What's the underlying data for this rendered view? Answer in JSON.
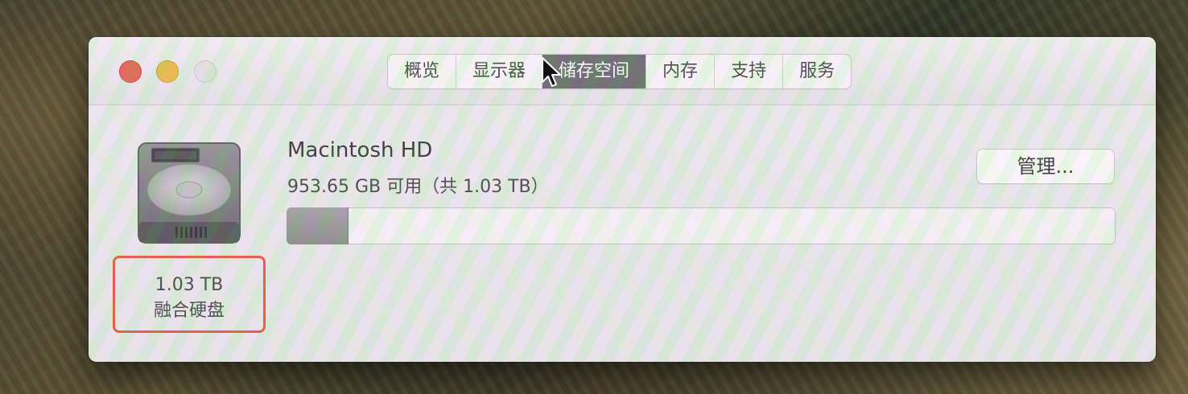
{
  "tabs": [
    {
      "label": "概览",
      "active": false
    },
    {
      "label": "显示器",
      "active": false
    },
    {
      "label": "储存空间",
      "active": true
    },
    {
      "label": "内存",
      "active": false
    },
    {
      "label": "支持",
      "active": false
    },
    {
      "label": "服务",
      "active": false
    }
  ],
  "disk": {
    "size": "1.03 TB",
    "type": "融合硬盘",
    "icon": "hard-drive-icon"
  },
  "volume": {
    "name": "Macintosh HD",
    "free_text": "953.65 GB 可用（共 1.03 TB）",
    "used_fraction": 0.074
  },
  "manage_button": {
    "label": "管理..."
  },
  "colors": {
    "close": "#e8504a",
    "minimize": "#eab53d",
    "tab_active": "#5d5c64",
    "highlight_box": "#e8452e"
  }
}
